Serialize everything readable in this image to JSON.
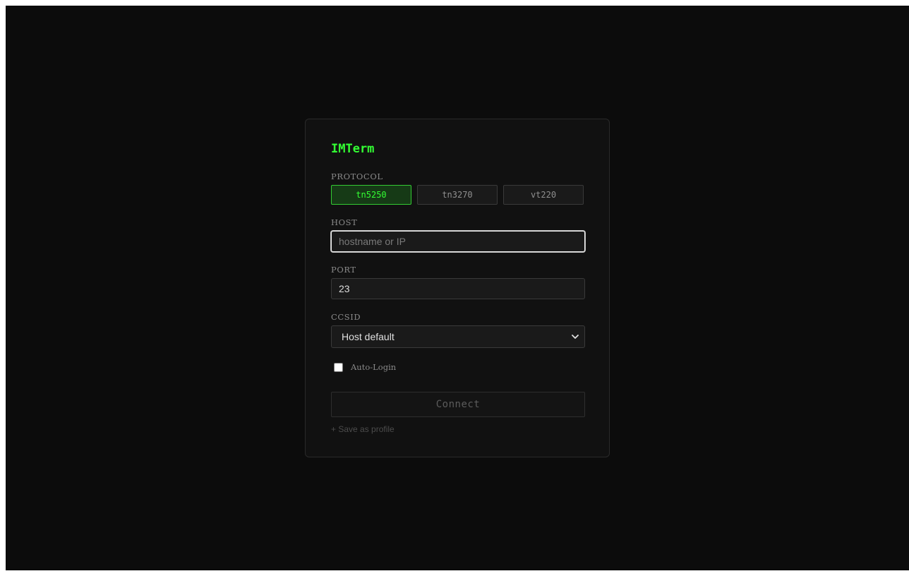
{
  "app": {
    "title": "IMTerm"
  },
  "protocol": {
    "label": "PROTOCOL",
    "options": [
      "tn5250",
      "tn3270",
      "vt220"
    ],
    "selected": "tn5250"
  },
  "host": {
    "label": "HOST",
    "value": "",
    "placeholder": "hostname or IP"
  },
  "port": {
    "label": "PORT",
    "value": "23"
  },
  "ccsid": {
    "label": "CCSID",
    "selected": "Host default"
  },
  "auto_login": {
    "label": "Auto-Login",
    "checked": false
  },
  "actions": {
    "connect_label": "Connect",
    "save_profile_label": "+ Save as profile"
  },
  "colors": {
    "accent": "#33ff33",
    "background": "#0c0c0c",
    "card": "#111111"
  }
}
